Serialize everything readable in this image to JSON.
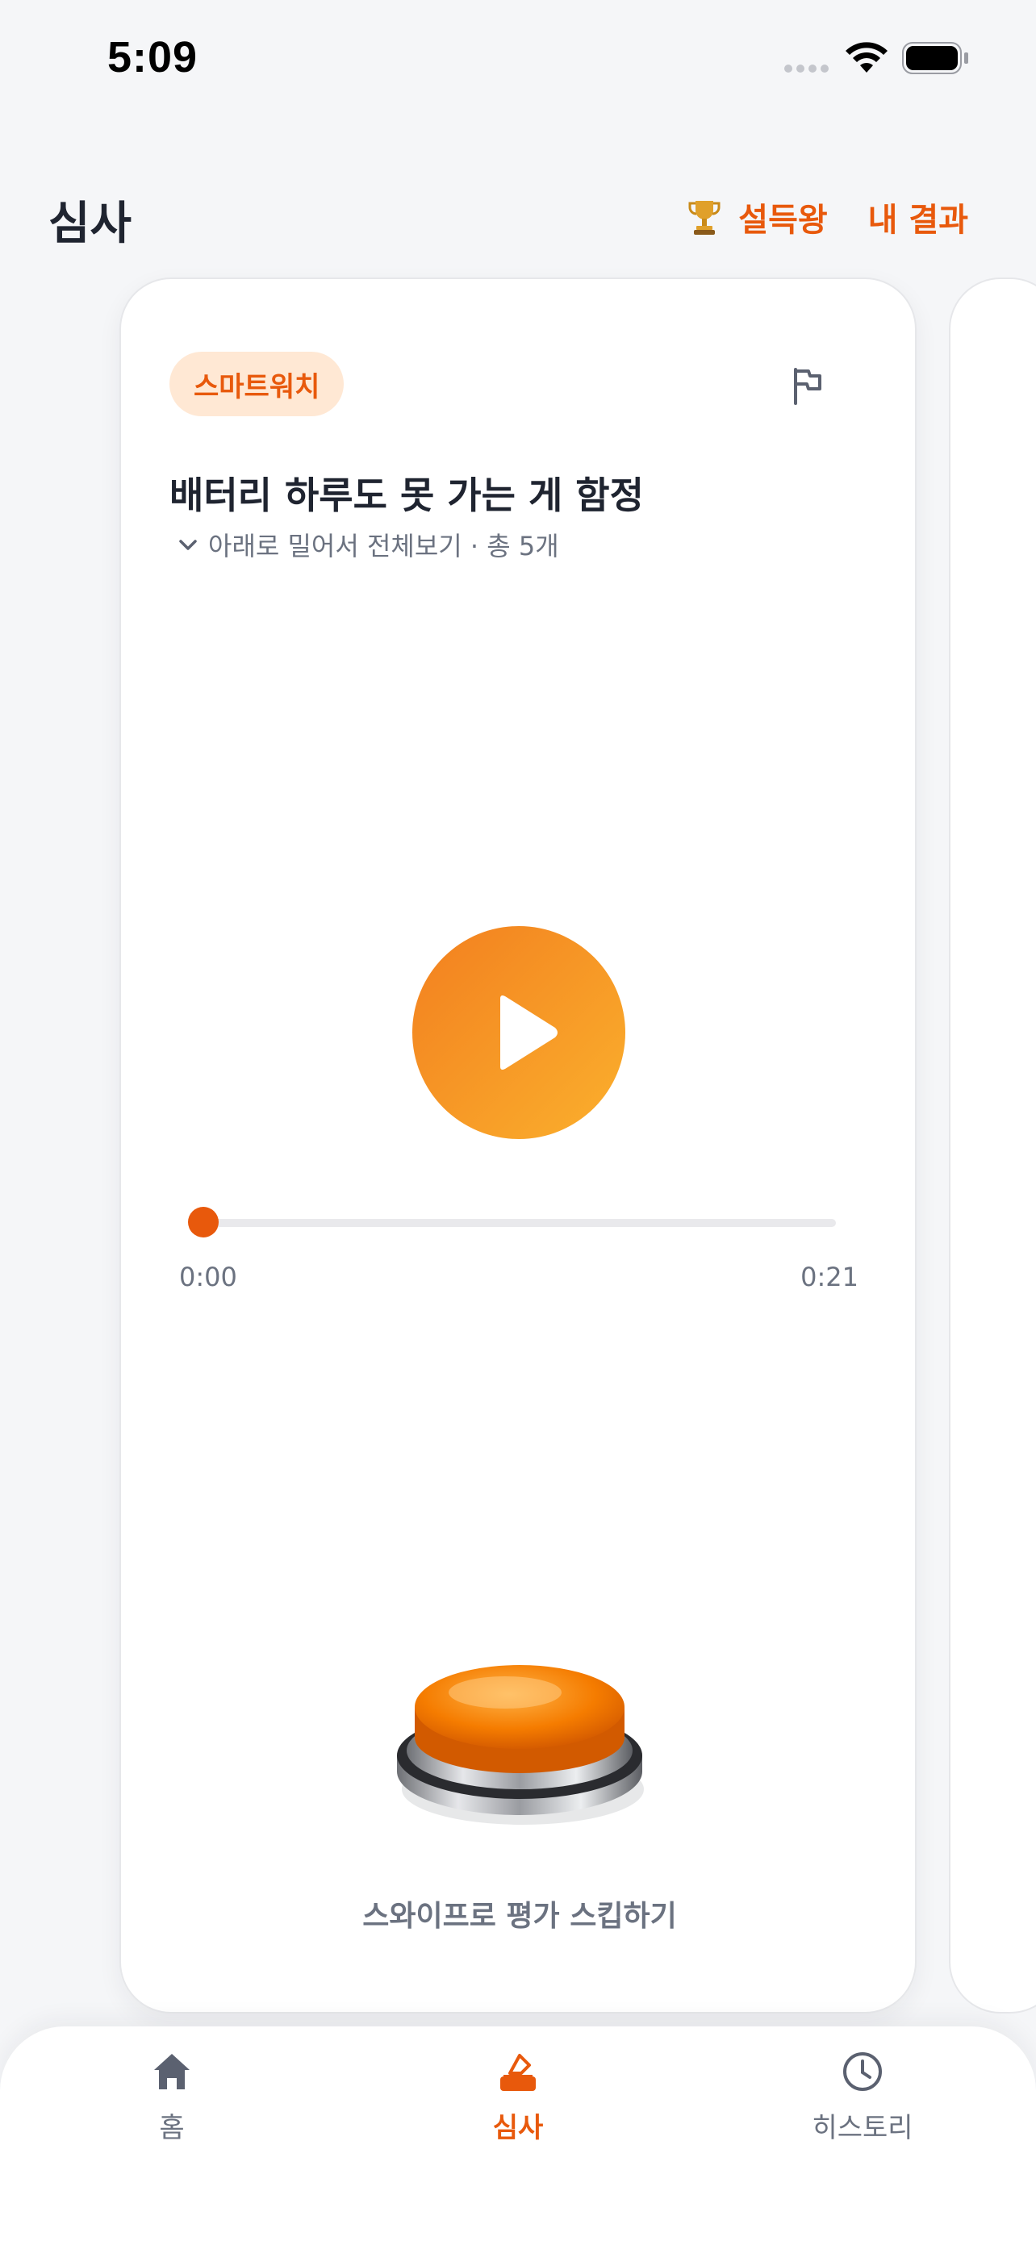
{
  "status_bar": {
    "time": "5:09",
    "icons": [
      "signal-dots-icon",
      "wifi-icon",
      "battery-icon"
    ]
  },
  "header": {
    "title": "심사",
    "persuasion_king": "설득왕",
    "my_results": "내 결과"
  },
  "card": {
    "category": "스마트워치",
    "title": "배터리 하루도 못 가는 게 함정",
    "scroll_hint": "아래로 밀어서 전체보기 · 총 5개",
    "audio": {
      "current_time": "0:00",
      "total_time": "0:21",
      "progress": 0
    },
    "skip_hint": "스와이프로 평가 스킵하기"
  },
  "tabs": [
    {
      "label": "홈",
      "icon": "home-icon",
      "active": false
    },
    {
      "label": "심사",
      "icon": "ballot-icon",
      "active": true
    },
    {
      "label": "히스토리",
      "icon": "clock-icon",
      "active": false
    }
  ],
  "colors": {
    "accent": "#e8590c",
    "accent_soft": "#ffe8d4",
    "play_gradient_start": "#f27f1f",
    "play_gradient_end": "#fbb02d",
    "background": "#f5f6f8",
    "muted_text": "#6b7280"
  }
}
